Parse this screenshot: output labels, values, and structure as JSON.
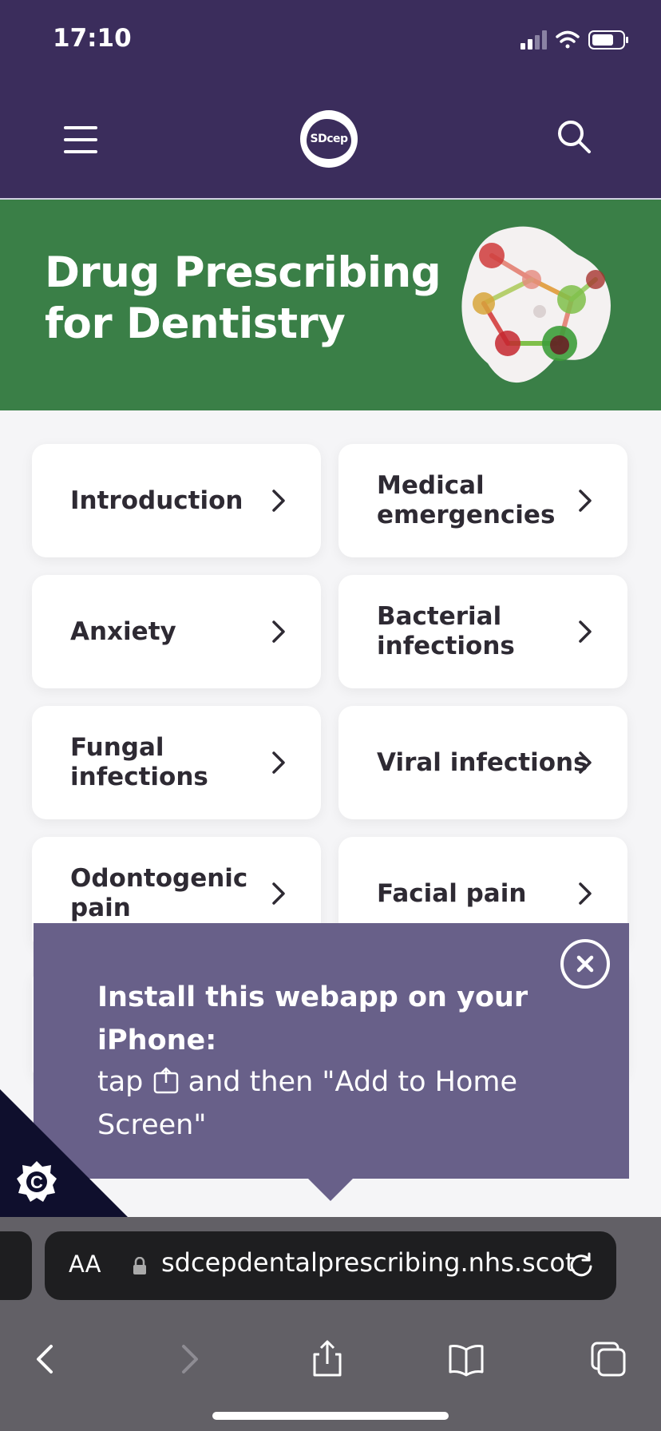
{
  "status_bar": {
    "time": "17:10"
  },
  "header": {
    "logo_text": "SDcep",
    "menu_icon": "hamburger-menu-icon",
    "search_icon": "search-icon"
  },
  "hero": {
    "title": "Drug Prescribing for Dentistry",
    "background_color": "#3a7f47"
  },
  "cards": [
    {
      "label": "Introduction"
    },
    {
      "label": "Medical emergencies"
    },
    {
      "label": "Anxiety"
    },
    {
      "label": "Bacterial infections"
    },
    {
      "label": "Fungal infections"
    },
    {
      "label": "Viral infections"
    },
    {
      "label": "Odontogenic pain"
    },
    {
      "label": "Facial pain"
    }
  ],
  "install_popup": {
    "title": "Install this webapp on your iPhone:",
    "text_before": "tap",
    "text_after": "and then \"Add to Home Screen\"",
    "close_icon": "close-icon",
    "background_color": "#686089"
  },
  "cookie_badge": {
    "letter": "C"
  },
  "browser": {
    "aa_label": "AA",
    "url": "sdcepdentalprescribing.nhs.scot",
    "toolbar": [
      "back-icon",
      "forward-icon",
      "share-icon",
      "bookmarks-icon",
      "tabs-icon"
    ]
  },
  "colors": {
    "brand_purple": "#3b2d5c",
    "text_dark": "#2e2a33"
  }
}
